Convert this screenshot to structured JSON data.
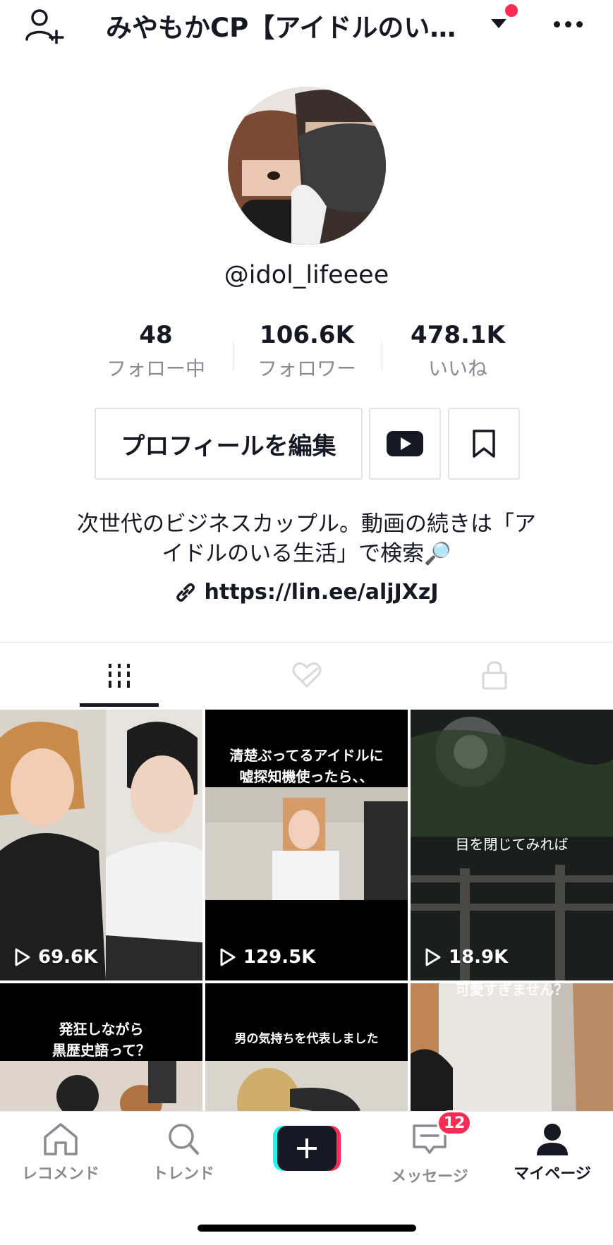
{
  "header": {
    "title": "みやもかCP【アイドルのい…",
    "icons": [
      "add-user-icon",
      "caret-down-icon",
      "more-icon"
    ],
    "notify_dot_color": "#fe2c55"
  },
  "profile": {
    "username": "@idol_lifeeee",
    "stats": [
      {
        "value": "48",
        "label": "フォロー中"
      },
      {
        "value": "106.6K",
        "label": "フォロワー"
      },
      {
        "value": "478.1K",
        "label": "いいね"
      }
    ],
    "edit_button_label": "プロフィールを編集",
    "bio_line1": "次世代のビジネスカップル。動画の続きは「ア",
    "bio_line2": "イドルのいる生活」で検索🔎",
    "link": "https://lin.ee/aljJXzJ"
  },
  "tabs": [
    {
      "name": "videos",
      "icon": "grid-icon",
      "active": true
    },
    {
      "name": "liked",
      "icon": "heart-hidden-icon",
      "active": false
    },
    {
      "name": "private",
      "icon": "lock-icon",
      "active": false
    }
  ],
  "videos": [
    {
      "views": "69.6K",
      "caption": ""
    },
    {
      "views": "129.5K",
      "caption_line1": "清楚ぶってるアイドルに",
      "caption_line2": "嘘探知機使ったら、、"
    },
    {
      "views": "18.9K",
      "caption": "目を閉じてみれば"
    },
    {
      "views": "",
      "caption_line1": "発狂しながら",
      "caption_line2": "黒歴史語って？"
    },
    {
      "views": "",
      "caption": "男の気持ちを代表しました"
    },
    {
      "views": "",
      "caption": "可愛すぎません？"
    }
  ],
  "bottom_nav": [
    {
      "label": "レコメンド",
      "icon": "home-icon"
    },
    {
      "label": "トレンド",
      "icon": "search-icon"
    },
    {
      "label": "",
      "icon": "plus-icon"
    },
    {
      "label": "メッセージ",
      "icon": "message-icon",
      "badge": "12"
    },
    {
      "label": "マイページ",
      "icon": "profile-icon",
      "active": true
    }
  ],
  "colors": {
    "accent": "#fe2c55",
    "text": "#161823",
    "muted": "#8a8b91",
    "cyan": "#25f4ee"
  }
}
